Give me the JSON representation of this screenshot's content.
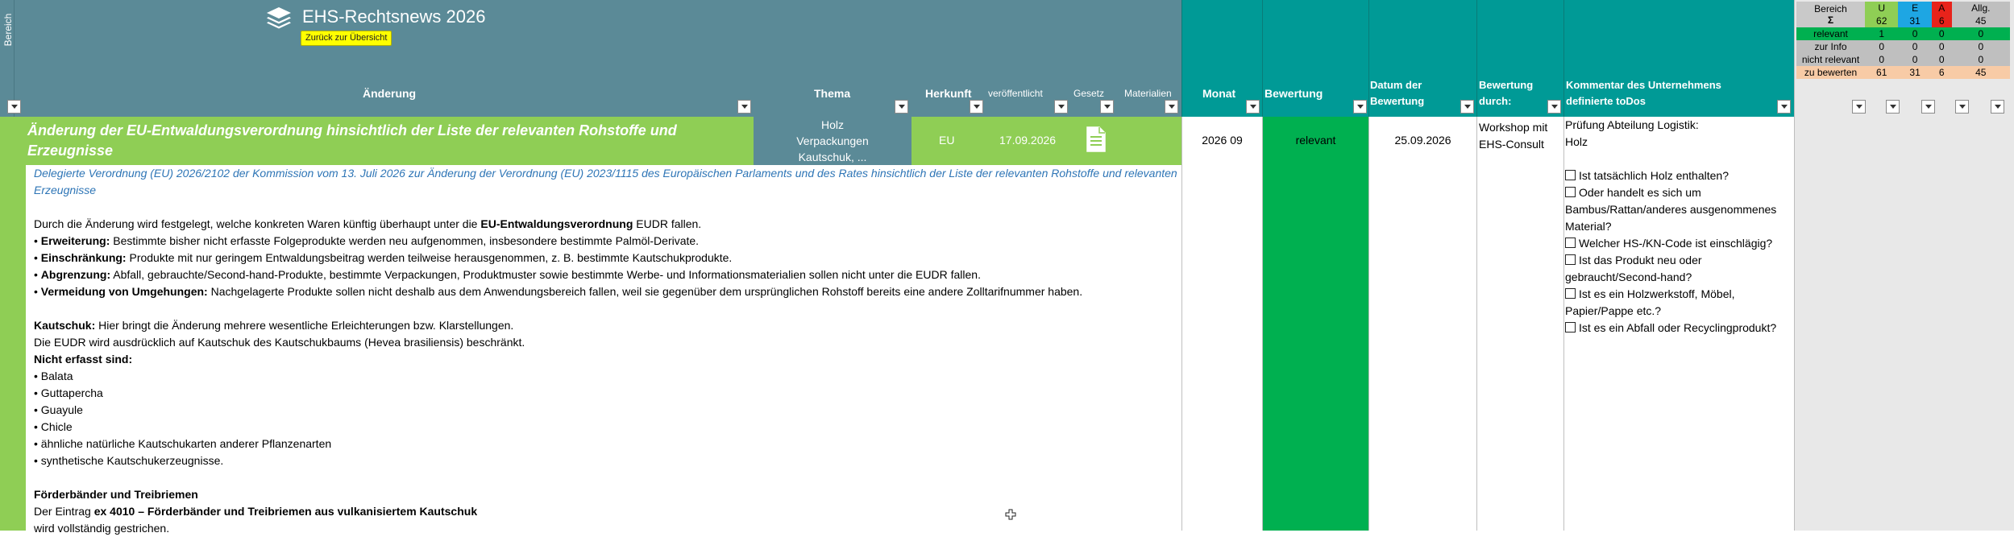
{
  "header": {
    "side_label": "Bereich",
    "title": "EHS-Rechtsnews 2026",
    "back_button": "Zurück zur Übersicht",
    "columns": {
      "aenderung": "Änderung",
      "thema": "Thema",
      "herkunft": "Herkunft",
      "veroeffentlicht": "veröffentlicht",
      "gesetz": "Gesetz",
      "materialien": "Materialien",
      "monat": "Monat",
      "bewertung": "Bewertung",
      "datum_line1": "Datum der",
      "datum_line2": "Bewertung",
      "bewertung_durch_line1": "Bewertung",
      "bewertung_durch_line2": "durch:",
      "kommentar_line1": "Kommentar des Unternehmens",
      "kommentar_line2": "definierte toDos"
    }
  },
  "stats": {
    "head": {
      "label": "Bereich",
      "sigma": "Σ",
      "cols": [
        "U",
        "E",
        "A",
        "Allg."
      ],
      "totals": [
        "62",
        "31",
        "6",
        "45"
      ]
    },
    "rows": [
      {
        "label": "relevant",
        "values": [
          "1",
          "0",
          "0",
          "0"
        ]
      },
      {
        "label": "zur Info",
        "values": [
          "0",
          "0",
          "0",
          "0"
        ]
      },
      {
        "label": "nicht relevant",
        "values": [
          "0",
          "0",
          "0",
          "0"
        ]
      },
      {
        "label": "zu bewerten",
        "values": [
          "61",
          "31",
          "6",
          "45"
        ]
      }
    ],
    "colors": {
      "bereich": "#c9c9c9",
      "U": "#8fce55",
      "E": "#1ea6e3",
      "A": "#e8231b",
      "Allg": "#bfbfbf",
      "relevant": "#00b050",
      "neutral": "#bfbfbf",
      "zu_bewerten": "#f8cba6"
    }
  },
  "entry": {
    "title": "Änderung der EU-Entwaldungsverordnung hinsichtlich der Liste der relevanten Rohstoffe und Erzeugnisse",
    "thema_lines": [
      "Holz",
      "Verpackungen",
      "Kautschuk, ..."
    ],
    "herkunft": "EU",
    "veroeffentlicht": "17.09.2026",
    "gesetz_icon": "document-icon",
    "monat": "2026 09",
    "bewertung": "relevant",
    "datum": "25.09.2026",
    "bewertung_durch": [
      "Workshop mit",
      "EHS-Consult"
    ],
    "subtitle": "Delegierte Verordnung (EU) 2026/2102 der Kommission vom 13. Juli 2026 zur Änderung der Verordnung (EU) 2023/1115 des Europäischen Parlaments und des Rates hinsichtlich der Liste der relevanten Rohstoffe und relevanten Erzeugnisse",
    "body": {
      "intro_pre": "Durch die Änderung wird festgelegt, welche konkreten Waren künftig überhaupt unter die ",
      "intro_bold": "EU-Entwaldungsverordnung",
      "intro_post": " EUDR fallen.",
      "bullets": [
        {
          "bold": "Erweiterung:",
          "text": " Bestimmte bisher nicht erfasste Folgeprodukte werden neu aufgenommen, insbesondere bestimmte Palmöl-Derivate."
        },
        {
          "bold": "Einschränkung:",
          "text": " Produkte mit nur geringem Entwaldungsbeitrag werden teilweise herausgenommen, z. B. bestimmte Kautschukprodukte."
        },
        {
          "bold": "Abgrenzung:",
          "text": " Abfall, gebrauchte/Second-hand-Produkte, bestimmte Verpackungen, Produktmuster sowie bestimmte Werbe- und Informationsmaterialien sollen nicht unter die EUDR fallen."
        },
        {
          "bold": "Vermeidung von Umgehungen:",
          "text": " Nachgelagerte Produkte sollen nicht deshalb aus dem Anwendungsbereich fallen, weil sie gegenüber dem ursprünglichen Rohstoff bereits eine andere Zolltarifnummer haben."
        }
      ],
      "kautschuk_bold": "Kautschuk:",
      "kautschuk_text": " Hier bringt die Änderung mehrere wesentliche Erleichterungen bzw. Klarstellungen.",
      "kautschuk_line2": "Die EUDR wird ausdrücklich auf Kautschuk des Kautschukbaums (Hevea brasiliensis) beschränkt.",
      "nicht_erfasst": "Nicht erfasst sind:",
      "nicht_erfasst_items": [
        "Balata",
        "Guttapercha",
        "Guayule",
        "Chicle",
        "ähnliche natürliche Kautschukarten anderer Pflanzenarten",
        "synthetische Kautschukerzeugnisse."
      ],
      "foerder_heading": "Förderbänder und Treibriemen",
      "foerder_pre": "Der Eintrag ",
      "foerder_bold": "ex 4010 – Förderbänder und Treibriemen aus vulkanisiertem Kautschuk",
      "foerder_last": "wird vollständig gestrichen."
    },
    "kommentar_intro": [
      "Prüfung Abteilung Logistik:",
      "Holz"
    ],
    "checklist": [
      "Ist tatsächlich Holz enthalten?",
      "Oder handelt es sich um Bambus/Rattan/anderes ausgenommenes Material?",
      "Welcher HS-/KN-Code ist einschlägig?",
      "Ist das Produkt neu oder gebraucht/Second-hand?",
      "Ist es ein Holzwerkstoff, Möbel, Papier/Pappe etc.?",
      "Ist es ein Abfall oder Recyclingprodukt?"
    ]
  }
}
